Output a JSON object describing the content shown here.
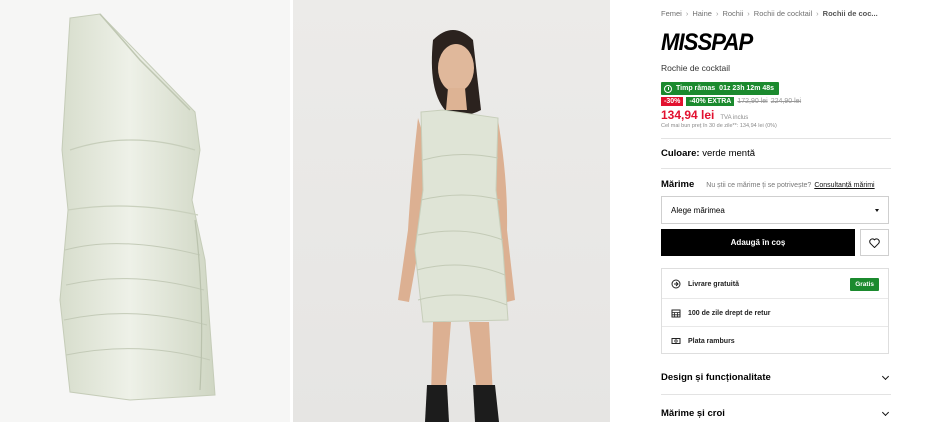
{
  "gallery": {
    "images": [
      {
        "alt": "dress-flat-image"
      },
      {
        "alt": "model-wearing-dress-image"
      }
    ]
  },
  "breadcrumb": [
    "Femei",
    "Haine",
    "Rochii",
    "Rochii de cocktail",
    "Rochii de coc..."
  ],
  "product": {
    "brand": "MISSPAP",
    "type": "Rochie de cocktail",
    "timer_label": "Timp rămas",
    "timer_value": "01z 23h 12m 48s",
    "discount": "-30%",
    "extra": "-40% EXTRA",
    "old_price_1": "172,90 lei",
    "old_price_2": "224,90 lei",
    "price": "134,94 lei",
    "vat": "TVA inclus",
    "lowest_price": "Cel mai bun preț în 30 de zile**: 134,94 lei (0%)",
    "color_label": "Culoare:",
    "color_value": "verde mentă"
  },
  "size": {
    "label": "Mărime",
    "question": "Nu știi ce mărime ți se potrivește?",
    "link": "Consultanță mărimi",
    "placeholder": "Alege mărimea"
  },
  "actions": {
    "add_to_cart": "Adaugă în coș"
  },
  "services": {
    "delivery": "Livrare gratuită",
    "delivery_badge": "Gratis",
    "returns": "100 de zile drept de retur",
    "payment": "Plata ramburs"
  },
  "accordions": [
    "Design și funcționalitate",
    "Mărime și croi"
  ],
  "colors": {
    "sale_red": "#e2112f",
    "promo_green": "#1b8a2e",
    "dress_mint": "#dfe4d6"
  }
}
